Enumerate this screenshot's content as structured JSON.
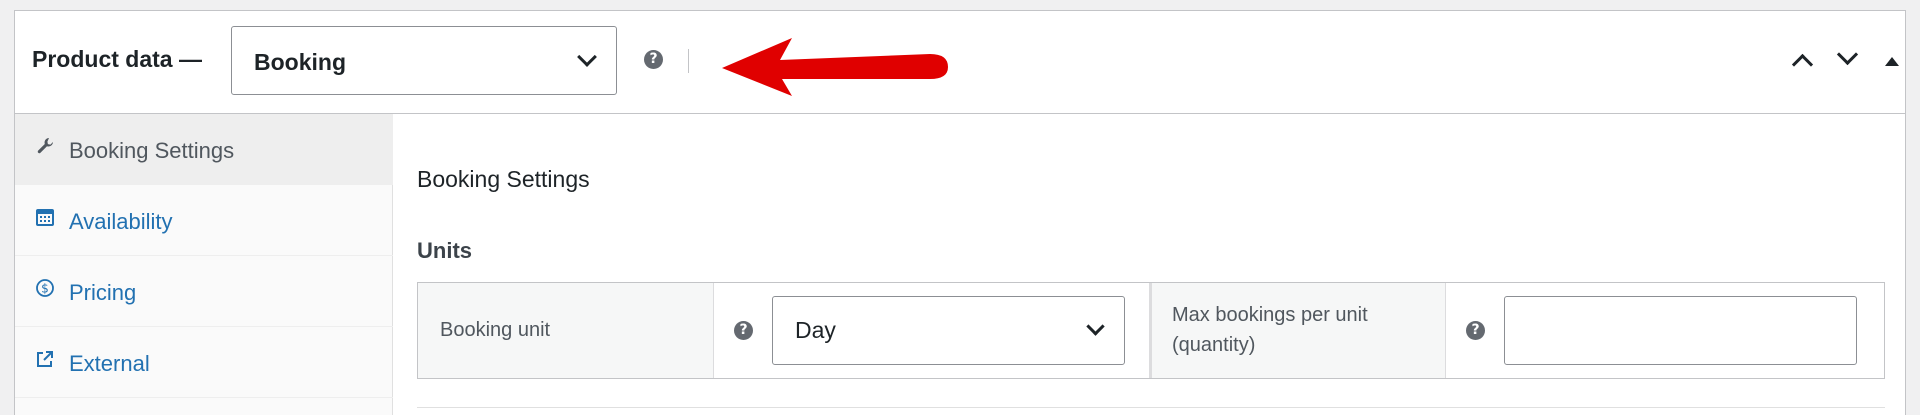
{
  "header": {
    "title": "Product data —",
    "product_type": "Booking"
  },
  "tabs": [
    {
      "label": "Booking Settings",
      "icon": "wrench-icon",
      "active": true
    },
    {
      "label": "Availability",
      "icon": "calendar-icon",
      "active": false
    },
    {
      "label": "Pricing",
      "icon": "dollar-icon",
      "active": false
    },
    {
      "label": "External",
      "icon": "external-link-icon",
      "active": false
    }
  ],
  "content": {
    "section_title": "Booking Settings",
    "subheading": "Units",
    "booking_unit_label": "Booking unit",
    "booking_unit_value": "Day",
    "max_bookings_label_line1": "Max bookings per unit",
    "max_bookings_label_line2": "(quantity)",
    "max_bookings_value": ""
  },
  "help_glyph": "?",
  "colors": {
    "link": "#2271b1",
    "annotation_arrow": "#e00000",
    "border": "#c3c4c7"
  }
}
